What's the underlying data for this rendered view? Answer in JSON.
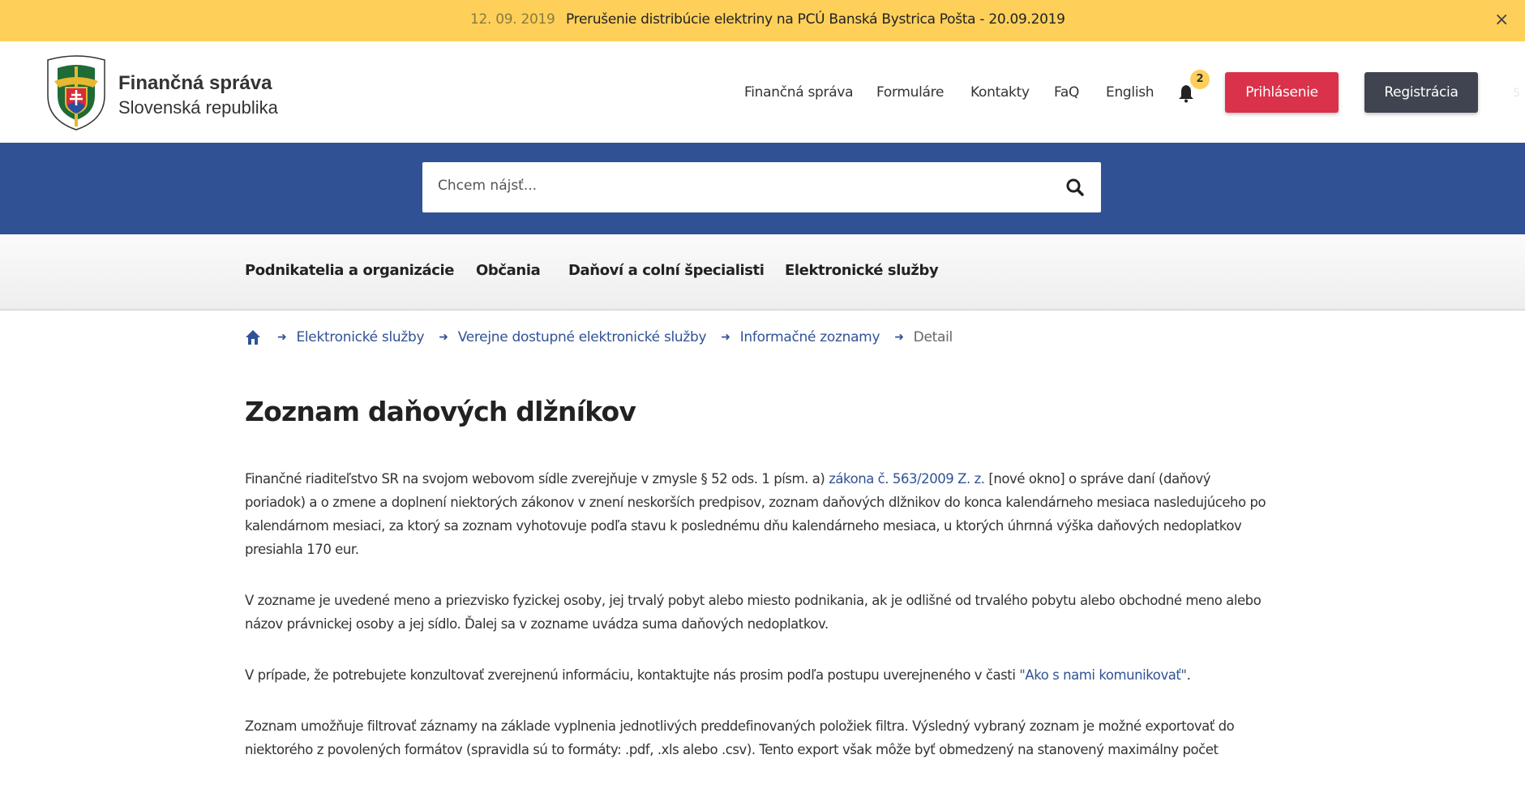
{
  "announcement": {
    "date": "12. 09. 2019",
    "message": "Prerušenie distribúcie elektriny na PCÚ Banská Bystrica Pošta - 20.09.2019",
    "close": "×"
  },
  "header": {
    "brand_line1": "Finančná správa",
    "brand_line2": "Slovenská republika",
    "logo_text": "FINANČNÁ SPRÁVA SLOVENSKÁ REPUBLIKA",
    "nav": [
      "Finančná správa",
      "Formuláre",
      "Kontakty",
      "FaQ",
      "English"
    ],
    "notification_count": "2",
    "login": "Prihlásenie",
    "register": "Registrácia",
    "corner_mark": "5"
  },
  "search": {
    "placeholder": "Chcem nájsť..."
  },
  "main_nav": [
    "Podnikatelia a organizácie",
    "Občania",
    "Daňoví a colní špecialisti",
    "Elektronické služby"
  ],
  "breadcrumb": [
    "Elektronické služby",
    "Verejne dostupné elektronické služby",
    "Informačné zoznamy",
    "Detail"
  ],
  "title": "Zoznam daňových dlžníkov",
  "paragraphs": {
    "p1_a": "Finančné riaditeľstvo SR na svojom webovom sídle zverejňuje v zmysle § 52 ods. 1 písm. a) ",
    "p1_link": "zákona č. 563/2009 Z. z.",
    "p1_b": " [nové okno] o správe daní (daňový poriadok) a o zmene a doplnení niektorých zákonov v znení neskorších predpisov, zoznam daňových dlžnikov do konca kalendárneho mesiaca nasledujúceho po kalendárnom mesiaci, za ktorý sa zoznam vyhotovuje podľa stavu k poslednému dňu kalendárneho mesiaca, u ktorých úhrnná výška daňových nedoplatkov presiahla 170 eur.",
    "p2": "V zozname je uvedené meno a priezvisko fyzickej osoby, jej trvalý pobyt alebo miesto podnikania, ak je odlišné od trvalého pobytu alebo obchodné meno alebo názov právnickej osoby a jej sídlo. Ďalej sa v zozname uvádza suma daňových nedoplatkov.",
    "p3_a": "V prípade, že potrebujete konzultovať zverejnenú informáciu, kontaktujte nás prosim podľa postupu uverejneného v časti ",
    "p3_link": "\"Ako s nami komunikovať\"",
    "p3_b": ".",
    "p4": "Zoznam umožňuje filtrovať záznamy na základe vyplnenia jednotlivých preddefinovaných položiek filtra. Výsledný vybraný zoznam je možné exportovať do niektorého z povolených formátov (spravidla sú to formáty: .pdf, .xls alebo .csv). Tento export však môže byť obmedzený na stanovený maximálny počet"
  },
  "colors": {
    "announcement": "#fed05a",
    "brand_blue": "#305295",
    "login": "#d9324a",
    "register": "#3f4450"
  }
}
